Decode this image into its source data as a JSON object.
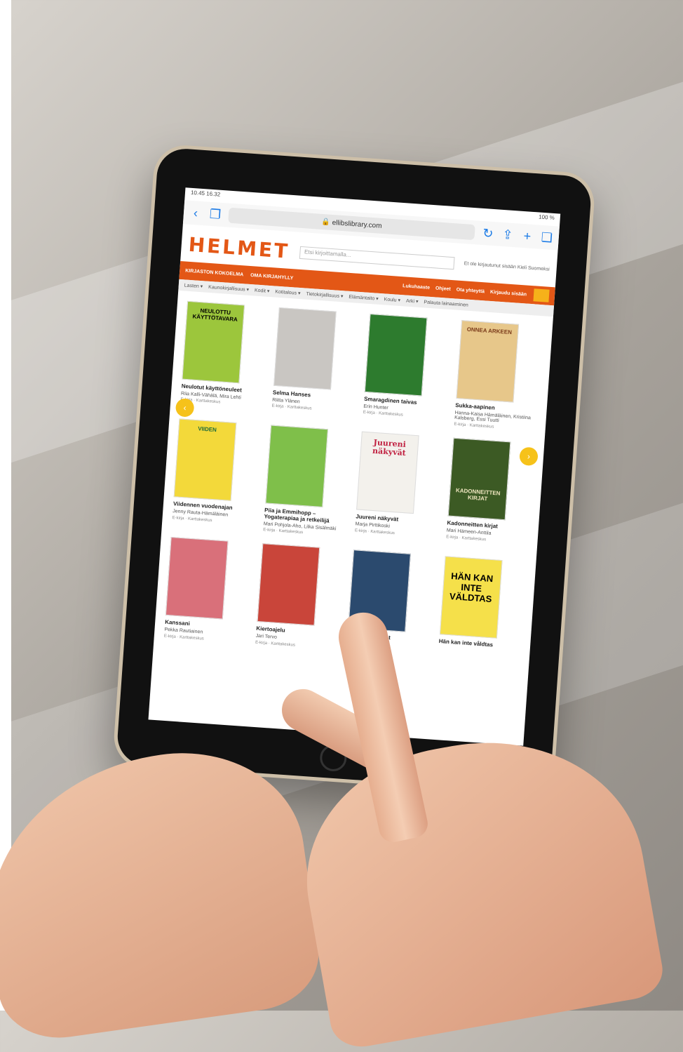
{
  "status": {
    "time": "10.45 16.32",
    "battery": "100 %"
  },
  "browser": {
    "url": "ellibslibrary.com"
  },
  "site": {
    "logo": "HELMET",
    "search_placeholder": "Etsi kirjoittamalla...",
    "header_links": "Et ole kirjautunut sisään   Kieli   Suomeksi",
    "orange_left": [
      "KIRJASTON KOKOELMA",
      "OMA KIRJAHYLLY"
    ],
    "orange_right": [
      "Lukuhaaste",
      "Ohjeet",
      "Ota yhteyttä",
      "Kirjaudu sisään"
    ],
    "categories": [
      "Lasten ▾",
      "Kaunokirjallisuus ▾",
      "Kodit ▾",
      "Kotitalous ▾",
      "Tietokirjallisuus ▾",
      "Elämäntaito ▾",
      "Koulu ▾",
      "Arki ▾",
      "Palauta lainaaminen"
    ]
  },
  "books": [
    {
      "cover_text": "NEULOTTU KÄYTTÖTAVARA",
      "cover_color": "#9cc63c",
      "title": "Neulotut käyttöneuleet",
      "author": "Riia Kalli-Vähälä, Mira Lehti",
      "meta": "E-kirja · Karttakeskus"
    },
    {
      "cover_text": "",
      "cover_color": "#c9c6c2",
      "title": "Selma Hanses",
      "author": "Riitta Ylänen",
      "meta": "E-kirja · Karttakeskus"
    },
    {
      "cover_text": "",
      "cover_color": "#2d7b2e",
      "title": "Smaragdinen taivas",
      "author": "Erin Hunter",
      "meta": "E-kirja · Karttakeskus"
    },
    {
      "cover_text": "ONNEA ARKEEN",
      "cover_color": "#e7c78a",
      "title": "Sukka-aapinen",
      "author": "Hanna-Kaisa Hämäläinen, Kristiina Kalsberg, Essi Tuutti",
      "meta": "E-kirja · Karttakeskus"
    },
    {
      "cover_text": "VIIDEN",
      "cover_color": "#f3d93a",
      "title": "Viidennen vuodenajan",
      "author": "Jenny Rauta-Hämäläinen",
      "meta": "E-kirja · Karttakeskus"
    },
    {
      "cover_text": "",
      "cover_color": "#7fbf4a",
      "title": "Piia ja Emmihopp – Yogaterapiaa ja retkeilijä",
      "author": "Mari Pohjola-Aho, Lilka Sisälmäki",
      "meta": "E-kirja · Karttakeskus"
    },
    {
      "cover_text": "Juureni näkyvät",
      "cover_color": "#f3f1ec",
      "title": "Juureni näkyvät",
      "author": "Marja Pirttikoski",
      "meta": "E-kirja · Karttakeskus"
    },
    {
      "cover_text": "KADONNEITTEN KIRJAT",
      "cover_color": "#3c5a24",
      "title": "Kadonneitten kirjat",
      "author": "Mari Hämeen-Anttila",
      "meta": "E-kirja · Karttakeskus"
    },
    {
      "cover_text": "",
      "cover_color": "#d9707a",
      "title": "Kanssani",
      "author": "Pekka Rautiainen",
      "meta": "E-kirja · Karttakeskus"
    },
    {
      "cover_text": "",
      "cover_color": "#c9453a",
      "title": "Kiertoajelu",
      "author": "Jari Tervo",
      "meta": "E-kirja · Karttakeskus"
    },
    {
      "cover_text": "",
      "cover_color": "#2b4a6e",
      "title": "Kuoleman kevät",
      "author": "",
      "meta": ""
    },
    {
      "cover_text": "HÄN KAN INTE VÄLDTAS",
      "cover_color": "#f5e04a",
      "title": "Hän kan inte våldtas",
      "author": "",
      "meta": ""
    }
  ]
}
